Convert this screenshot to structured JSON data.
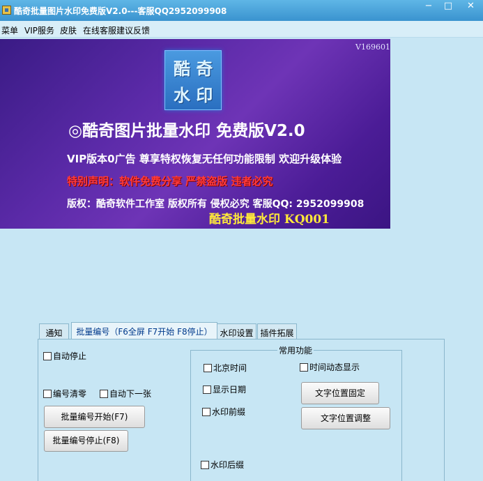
{
  "window": {
    "title": "酷奇批量图片水印免费版V2.0---客服QQ2952099908",
    "minimize": "−",
    "maximize": "□",
    "close": "✕"
  },
  "menu": [
    "菜单",
    "VIP服务",
    "皮肤",
    "在线客服建议反馈"
  ],
  "banner": {
    "version": "V169601",
    "logo_line1": "酷 奇",
    "logo_line2": "水 印",
    "title": "◎酷奇图片批量水印 免费版V2.0",
    "subtitle": "VIP版本0广告 尊享特权恢复无任何功能限制 欢迎升级体验",
    "warning": "特别声明：软件免费分享  严禁盗版  违者必究",
    "copyright": "版权：酷奇软件工作室 版权所有 侵权必究 客服QQ: 2952099908",
    "brand": "酷奇批量水印    KQ001"
  },
  "tabs": [
    "通知",
    "批量编号（F6全屏 F7开始 F8停止）",
    "水印设置",
    "插件拓展"
  ],
  "batch": {
    "auto_stop": "自动停止",
    "number_clear": "编号清零",
    "auto_next": "自动下一张",
    "start_button": "批量编号开始(F7)",
    "stop_button": "批量编号停止(F8)"
  },
  "common": {
    "group_title": "常用功能",
    "beijing_time": "北京时间",
    "time_dynamic": "时间动态显示",
    "show_date": "显示日期",
    "prefix": "水印前缀",
    "suffix": "水印后缀",
    "fix_position": "文字位置固定",
    "adjust_position": "文字位置调整"
  }
}
